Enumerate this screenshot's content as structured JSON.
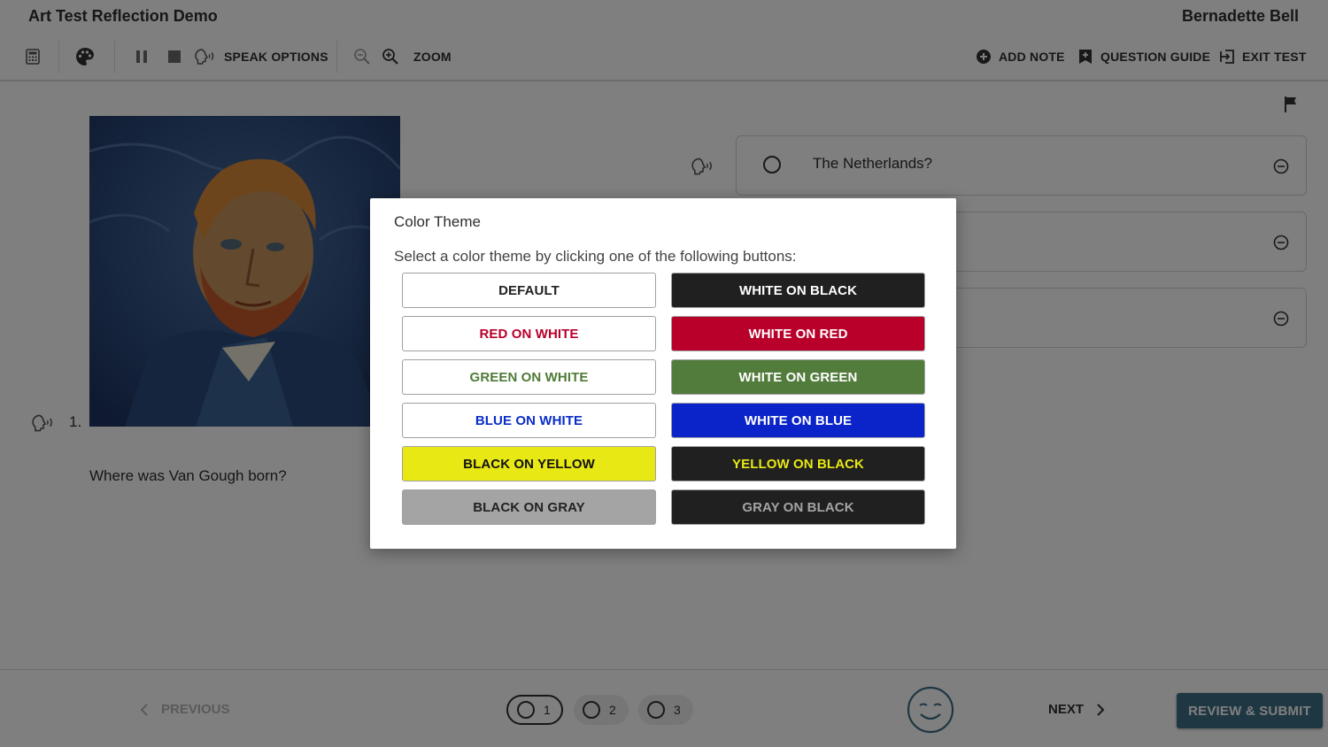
{
  "header": {
    "app_title": "Art Test Reflection Demo",
    "user_name": "Bernadette Bell",
    "toolbar": {
      "calculator_icon": "calculator-icon",
      "palette_icon": "palette-icon",
      "pause_icon": "pause-icon",
      "stop_icon": "stop-icon",
      "speak_options_label": "SPEAK OPTIONS",
      "zoom_out_icon": "zoom-out-icon",
      "zoom_in_icon": "zoom-in-icon",
      "zoom_label": "ZOOM",
      "add_note_label": "ADD NOTE",
      "question_guide_label": "QUESTION GUIDE",
      "exit_test_label": "EXIT TEST"
    }
  },
  "question": {
    "number": "1.",
    "text": "Where was Van Gough born?",
    "options": [
      {
        "label": "The Netherlands?"
      },
      {
        "label": ""
      },
      {
        "label": ""
      }
    ]
  },
  "footer": {
    "previous_label": "PREVIOUS",
    "next_label": "NEXT",
    "review_label": "REVIEW & SUBMIT",
    "pages": [
      {
        "label": "1",
        "active": true
      },
      {
        "label": "2",
        "active": false
      },
      {
        "label": "3",
        "active": false
      }
    ]
  },
  "modal": {
    "title": "Color Theme",
    "prompt": "Select a color theme by clicking one of the following buttons:",
    "themes": [
      {
        "label": "DEFAULT",
        "fg": "#222222",
        "bg": "#ffffff"
      },
      {
        "label": "WHITE ON BLACK",
        "fg": "#ffffff",
        "bg": "#202020"
      },
      {
        "label": "RED ON WHITE",
        "fg": "#b8002a",
        "bg": "#ffffff"
      },
      {
        "label": "WHITE ON RED",
        "fg": "#ffffff",
        "bg": "#b8002a"
      },
      {
        "label": "GREEN ON WHITE",
        "fg": "#4f7a37",
        "bg": "#ffffff"
      },
      {
        "label": "WHITE ON GREEN",
        "fg": "#ffffff",
        "bg": "#527c3c"
      },
      {
        "label": "BLUE ON WHITE",
        "fg": "#0a2dc9",
        "bg": "#ffffff"
      },
      {
        "label": "WHITE ON BLUE",
        "fg": "#ffffff",
        "bg": "#0a24c9"
      },
      {
        "label": "BLACK ON YELLOW",
        "fg": "#111111",
        "bg": "#e8e815"
      },
      {
        "label": "YELLOW ON BLACK",
        "fg": "#e8e815",
        "bg": "#202020"
      },
      {
        "label": "BLACK ON GRAY",
        "fg": "#222222",
        "bg": "#a4a4a4"
      },
      {
        "label": "GRAY ON BLACK",
        "fg": "#a4a4a4",
        "bg": "#202020"
      }
    ]
  }
}
